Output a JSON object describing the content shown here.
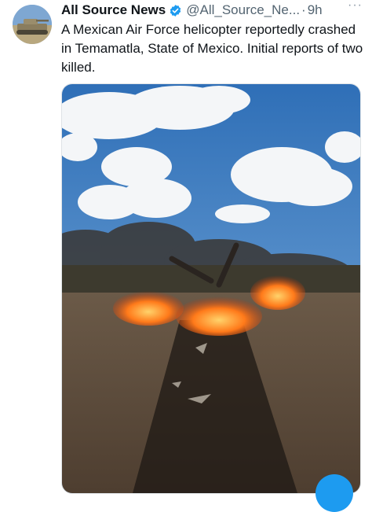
{
  "tweet": {
    "author_name": "All Source News",
    "handle": "@All_Source_Ne...",
    "separator": "·",
    "timestamp": "9h",
    "more": "···",
    "text": "A Mexican Air Force helicopter reportedly crashed in Temamatla, State of Mexico. Initial reports of two killed."
  },
  "icons": {
    "avatar": "tank-avatar",
    "verified": "verified-badge-icon",
    "more": "more-options-icon"
  },
  "colors": {
    "name": "#0f1419",
    "secondary": "#536471",
    "verified": "#1d9bf0",
    "fab": "#1d9bf0"
  }
}
